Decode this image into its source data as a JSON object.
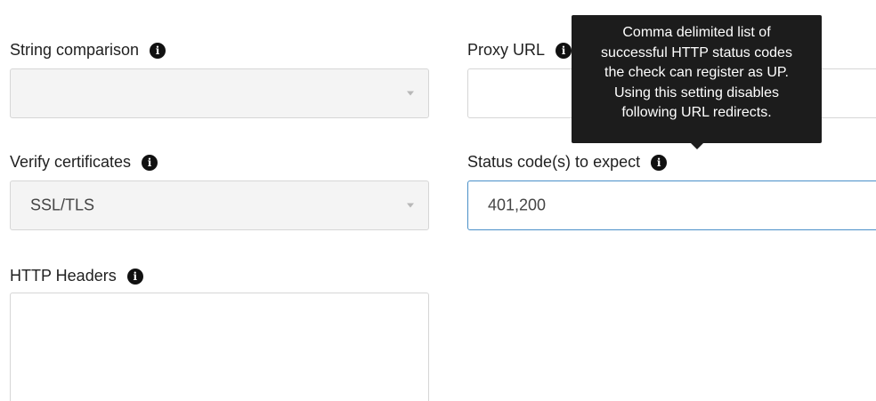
{
  "string_comparison": {
    "label": "String comparison",
    "value": ""
  },
  "proxy_url": {
    "label": "Proxy URL",
    "value": ""
  },
  "verify_certificates": {
    "label": "Verify certificates",
    "value": "SSL/TLS"
  },
  "status_codes": {
    "label": "Status code(s) to expect",
    "value": "401,200"
  },
  "http_headers": {
    "label": "HTTP Headers",
    "value": ""
  },
  "tooltip": {
    "lines": [
      "Comma delimited list of",
      "successful HTTP status codes",
      "the check can register as UP.",
      "Using this setting disables",
      "following URL redirects."
    ]
  },
  "icons": {
    "info": "i"
  },
  "colors": {
    "focus_border": "#4a90c8",
    "tooltip_bg": "#1c1c1c",
    "field_bg": "#f4f4f4"
  }
}
